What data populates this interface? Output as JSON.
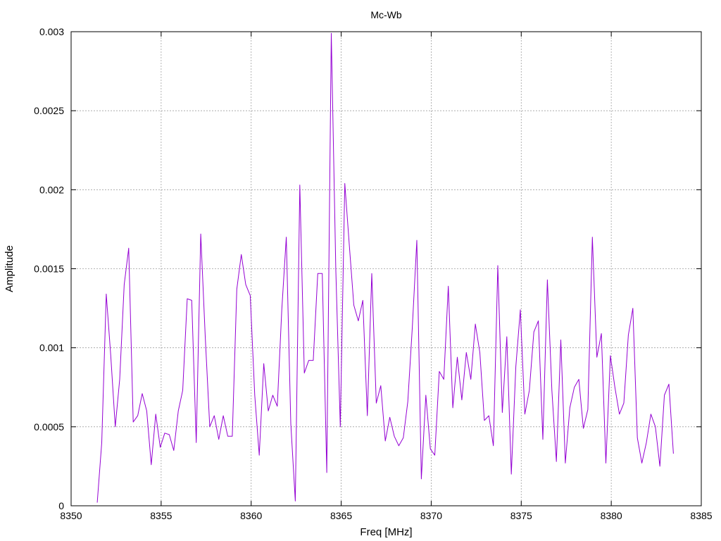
{
  "chart_data": {
    "type": "line",
    "title": "Mc-Wb",
    "xlabel": "Freq [MHz]",
    "ylabel": "Amplitude",
    "xlim": [
      8350,
      8385
    ],
    "ylim": [
      0,
      0.003
    ],
    "xticks": [
      8350,
      8355,
      8360,
      8365,
      8370,
      8375,
      8380,
      8385
    ],
    "xtick_labels": [
      "8350",
      "8355",
      "8360",
      "8365",
      "8370",
      "8375",
      "8380",
      "8385"
    ],
    "yticks": [
      0,
      0.0005,
      0.001,
      0.0015,
      0.002,
      0.0025,
      0.003
    ],
    "ytick_labels": [
      "0",
      "0.0005",
      "0.001",
      "0.0015",
      "0.002",
      "0.0025",
      "0.003"
    ],
    "grid": true,
    "series": [
      {
        "color": "#9400d3",
        "x": [
          8351.45,
          8351.7,
          8351.95,
          8352.2,
          8352.45,
          8352.7,
          8352.95,
          8353.2,
          8353.45,
          8353.7,
          8353.95,
          8354.2,
          8354.45,
          8354.7,
          8354.95,
          8355.2,
          8355.45,
          8355.7,
          8355.95,
          8356.2,
          8356.45,
          8356.7,
          8356.95,
          8357.2,
          8357.45,
          8357.7,
          8357.95,
          8358.2,
          8358.45,
          8358.7,
          8358.95,
          8359.2,
          8359.45,
          8359.7,
          8359.95,
          8360.2,
          8360.45,
          8360.7,
          8360.95,
          8361.2,
          8361.45,
          8361.7,
          8361.95,
          8362.2,
          8362.45,
          8362.7,
          8362.95,
          8363.2,
          8363.45,
          8363.7,
          8363.95,
          8364.2,
          8364.45,
          8364.7,
          8364.95,
          8365.2,
          8365.45,
          8365.7,
          8365.95,
          8366.2,
          8366.45,
          8366.7,
          8366.95,
          8367.2,
          8367.45,
          8367.7,
          8367.95,
          8368.2,
          8368.45,
          8368.7,
          8368.95,
          8369.2,
          8369.45,
          8369.7,
          8369.95,
          8370.2,
          8370.45,
          8370.7,
          8370.95,
          8371.2,
          8371.45,
          8371.7,
          8371.95,
          8372.2,
          8372.45,
          8372.7,
          8372.95,
          8373.2,
          8373.45,
          8373.7,
          8373.95,
          8374.2,
          8374.45,
          8374.7,
          8374.95,
          8375.2,
          8375.45,
          8375.7,
          8375.95,
          8376.2,
          8376.45,
          8376.7,
          8376.95,
          8377.2,
          8377.45,
          8377.7,
          8377.95,
          8378.2,
          8378.45,
          8378.7,
          8378.95,
          8379.2,
          8379.45,
          8379.7,
          8379.95,
          8380.2,
          8380.45,
          8380.7,
          8380.95,
          8381.2,
          8381.45,
          8381.7,
          8381.95,
          8382.2,
          8382.45,
          8382.7,
          8382.95,
          8383.2,
          8383.45
        ],
        "y": [
          2e-05,
          0.0004,
          0.00134,
          0.00095,
          0.0005,
          0.0008,
          0.0014,
          0.00163,
          0.00053,
          0.00057,
          0.00071,
          0.0006,
          0.00026,
          0.00058,
          0.00037,
          0.00046,
          0.00045,
          0.00035,
          0.0006,
          0.00073,
          0.00131,
          0.0013,
          0.0004,
          0.00172,
          0.00107,
          0.0005,
          0.00057,
          0.00042,
          0.00057,
          0.00044,
          0.00044,
          0.00137,
          0.00159,
          0.0014,
          0.00133,
          0.0007,
          0.00032,
          0.0009,
          0.0006,
          0.0007,
          0.00063,
          0.00124,
          0.0017,
          0.00052,
          3e-05,
          0.00203,
          0.00084,
          0.00092,
          0.00092,
          0.00147,
          0.00147,
          0.00021,
          0.00299,
          0.0015,
          0.0005,
          0.00204,
          0.00165,
          0.00127,
          0.00117,
          0.0013,
          0.00057,
          0.00147,
          0.00065,
          0.00076,
          0.00041,
          0.00056,
          0.00044,
          0.00038,
          0.00043,
          0.00066,
          0.00113,
          0.00168,
          0.00017,
          0.0007,
          0.00036,
          0.00032,
          0.00085,
          0.0008,
          0.00139,
          0.00062,
          0.00094,
          0.00067,
          0.00097,
          0.0008,
          0.00115,
          0.00097,
          0.00054,
          0.00057,
          0.00038,
          0.00152,
          0.00059,
          0.00107,
          0.0002,
          0.00088,
          0.00124,
          0.00058,
          0.00073,
          0.0011,
          0.00117,
          0.00042,
          0.00143,
          0.00073,
          0.00028,
          0.00105,
          0.00027,
          0.00062,
          0.00075,
          0.0008,
          0.00049,
          0.00061,
          0.0017,
          0.00094,
          0.00109,
          0.00027,
          0.00095,
          0.00075,
          0.00058,
          0.00065,
          0.00108,
          0.00125,
          0.00043,
          0.00027,
          0.0004,
          0.00058,
          0.0005,
          0.00025,
          0.0007,
          0.00077,
          0.00033
        ]
      }
    ]
  }
}
